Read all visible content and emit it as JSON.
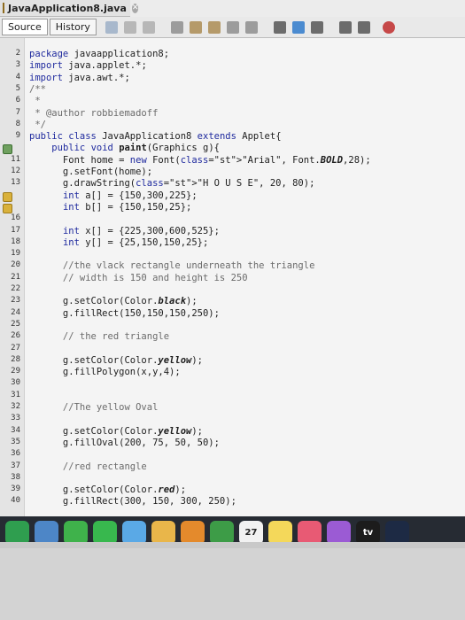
{
  "window": {
    "file_tab": "JavaApplication8.java"
  },
  "toolbar": {
    "source_label": "Source",
    "history_label": "History"
  },
  "gutter": {
    "line_numbers": [
      "2",
      "3",
      "4",
      "5",
      "6",
      "7",
      "8",
      "9",
      "",
      "11",
      "12",
      "13",
      "",
      "",
      "16",
      "17",
      "18",
      "19",
      "20",
      "21",
      "22",
      "23",
      "24",
      "25",
      "26",
      "27",
      "28",
      "29",
      "30",
      "31",
      "32",
      "33",
      "34",
      "35",
      "36",
      "37",
      "38",
      "39",
      "40"
    ]
  },
  "code_lines": [
    {
      "text": "package javaapplication8;"
    },
    {
      "text": "import java.applet.*;"
    },
    {
      "text": "import java.awt.*;"
    },
    {
      "text": "/**"
    },
    {
      "text": " *"
    },
    {
      "text": " * @author robbiemadoff"
    },
    {
      "text": " */"
    },
    {
      "text": "public class JavaApplication8 extends Applet{"
    },
    {
      "text": "    public void paint(Graphics g){"
    },
    {
      "text": "      Font home = new Font(\"Arial\", Font.BOLD,28);"
    },
    {
      "text": "      g.setFont(home);"
    },
    {
      "text": "      g.drawString(\"H O U S E\", 20, 80);"
    },
    {
      "text": "      int a[] = {150,300,225};"
    },
    {
      "text": "      int b[] = {150,150,25};"
    },
    {
      "text": ""
    },
    {
      "text": "      int x[] = {225,300,600,525};"
    },
    {
      "text": "      int y[] = {25,150,150,25};"
    },
    {
      "text": ""
    },
    {
      "text": "      //the vlack rectangle underneath the triangle"
    },
    {
      "text": "      // width is 150 and height is 250"
    },
    {
      "text": ""
    },
    {
      "text": "      g.setColor(Color.black);"
    },
    {
      "text": "      g.fillRect(150,150,150,250);"
    },
    {
      "text": ""
    },
    {
      "text": "      // the red triangle"
    },
    {
      "text": ""
    },
    {
      "text": "      g.setColor(Color.yellow);"
    },
    {
      "text": "      g.fillPolygon(x,y,4);"
    },
    {
      "text": ""
    },
    {
      "text": ""
    },
    {
      "text": "      //The yellow Oval"
    },
    {
      "text": ""
    },
    {
      "text": "      g.setColor(Color.yellow);"
    },
    {
      "text": "      g.fillOval(200, 75, 50, 50);"
    },
    {
      "text": ""
    },
    {
      "text": "      //red rectangle"
    },
    {
      "text": ""
    },
    {
      "text": "      g.setColor(Color.red);"
    },
    {
      "text": "      g.fillRect(300, 150, 300, 250);"
    }
  ],
  "dock": {
    "items": [
      {
        "icon": "chrome-icon"
      },
      {
        "icon": "preview-icon"
      },
      {
        "icon": "facetime-icon"
      },
      {
        "icon": "messages-icon"
      },
      {
        "icon": "finder-icon"
      },
      {
        "icon": "photos-icon"
      },
      {
        "icon": "pages-icon"
      },
      {
        "icon": "numbers-icon"
      },
      {
        "icon": "calendar-icon",
        "label": "27"
      },
      {
        "icon": "notes-icon"
      },
      {
        "icon": "music-icon"
      },
      {
        "icon": "podcasts-icon"
      },
      {
        "icon": "tv-icon",
        "label": "tv"
      },
      {
        "icon": "stocks-icon"
      }
    ],
    "colors": {
      "chrome-icon": "#2f9e4f",
      "preview-icon": "#4d86c7",
      "facetime-icon": "#3fb24b",
      "messages-icon": "#38b84e",
      "finder-icon": "#5aa9e6",
      "photos-icon": "#e9b64a",
      "pages-icon": "#e48a2c",
      "numbers-icon": "#3d9c47",
      "calendar-icon": "#f2f2f2",
      "notes-icon": "#f4d85a",
      "music-icon": "#e85a74",
      "podcasts-icon": "#9b5bd4",
      "tv-icon": "#1c1c1c",
      "stocks-icon": "#1d2a44"
    }
  },
  "colors": {
    "keyword": "#1f2a9e",
    "comment": "#6b6b6b",
    "string": "#b0642b",
    "accent": "#d9b13b"
  }
}
